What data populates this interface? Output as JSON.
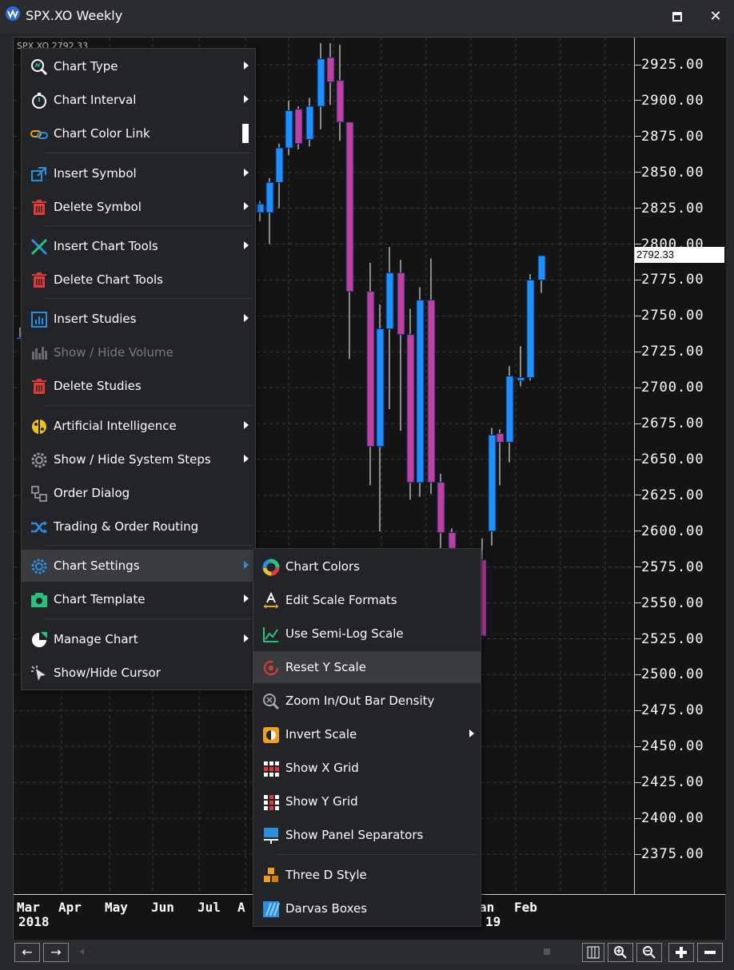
{
  "window": {
    "title": "SPX.XO Weekly",
    "symbol_partial": "SPX.XO  2792.33"
  },
  "chart": {
    "current_price": "2792.33",
    "y_ticks": [
      "2925.00",
      "2900.00",
      "2875.00",
      "2850.00",
      "2825.00",
      "2800.00",
      "2775.00",
      "2750.00",
      "2725.00",
      "2700.00",
      "2675.00",
      "2650.00",
      "2625.00",
      "2600.00",
      "2575.00",
      "2550.00",
      "2525.00",
      "2500.00",
      "2475.00",
      "2450.00",
      "2425.00",
      "2400.00",
      "2375.00"
    ],
    "x_labels_row1": [
      "Mar",
      "Apr",
      "May",
      "Jun",
      "Jul",
      "A",
      "an",
      "Feb"
    ],
    "x_labels_row2": [
      "2018",
      "19"
    ],
    "colors": {
      "up": "#1e90ff",
      "down": "#c040a0",
      "background": "#141414",
      "grid": "#3a3a3a"
    }
  },
  "context_menu": {
    "items": [
      {
        "label": "Chart Type",
        "icon": "chart-type-icon",
        "submenu": true
      },
      {
        "label": "Chart Interval",
        "icon": "stopwatch-icon",
        "submenu": true
      },
      {
        "label": "Chart Color Link",
        "icon": "link-icon",
        "submenu": false
      },
      {
        "label": "Insert Symbol",
        "icon": "insert-symbol-icon",
        "submenu": true
      },
      {
        "label": "Delete Symbol",
        "icon": "trash-icon",
        "submenu": true
      },
      {
        "label": "Insert Chart Tools",
        "icon": "tools-icon",
        "submenu": true
      },
      {
        "label": "Delete Chart Tools",
        "icon": "trash-icon",
        "submenu": false
      },
      {
        "label": "Insert Studies",
        "icon": "studies-icon",
        "submenu": true
      },
      {
        "label": "Show / Hide Volume",
        "icon": "volume-icon",
        "submenu": false,
        "disabled": true
      },
      {
        "label": "Delete Studies",
        "icon": "trash-icon",
        "submenu": false
      },
      {
        "label": "Artificial Intelligence",
        "icon": "brain-icon",
        "submenu": true
      },
      {
        "label": "Show / Hide System Steps",
        "icon": "gear-icon",
        "submenu": true
      },
      {
        "label": "Order Dialog",
        "icon": "order-dialog-icon",
        "submenu": false
      },
      {
        "label": "Trading & Order Routing",
        "icon": "shuffle-icon",
        "submenu": false
      },
      {
        "label": "Chart Settings",
        "icon": "settings-gear-icon",
        "submenu": true,
        "highlighted": true
      },
      {
        "label": "Chart Template",
        "icon": "template-icon",
        "submenu": true
      },
      {
        "label": "Manage Chart",
        "icon": "manage-chart-icon",
        "submenu": true
      },
      {
        "label": "Show/Hide Cursor",
        "icon": "cursor-icon",
        "submenu": false
      }
    ]
  },
  "submenu": {
    "items": [
      {
        "label": "Chart Colors",
        "icon": "color-wheel-icon",
        "submenu": false
      },
      {
        "label": "Edit Scale Formats",
        "icon": "scale-format-icon",
        "submenu": false
      },
      {
        "label": "Use Semi-Log Scale",
        "icon": "semi-log-icon",
        "submenu": false
      },
      {
        "label": "Reset Y Scale",
        "icon": "reset-scale-icon",
        "submenu": false,
        "highlighted": true
      },
      {
        "label": "Zoom In/Out Bar Density",
        "icon": "zoom-density-icon",
        "submenu": false
      },
      {
        "label": "Invert Scale",
        "icon": "invert-scale-icon",
        "submenu": true
      },
      {
        "label": "Show X Grid",
        "icon": "x-grid-icon",
        "submenu": false
      },
      {
        "label": "Show Y Grid",
        "icon": "y-grid-icon",
        "submenu": false
      },
      {
        "label": "Show Panel Separators",
        "icon": "panel-separator-icon",
        "submenu": false
      },
      {
        "label": "Three D Style",
        "icon": "three-d-icon",
        "submenu": false
      },
      {
        "label": "Darvas Boxes",
        "icon": "darvas-icon",
        "submenu": false
      }
    ]
  },
  "bottombar": {
    "left": "←",
    "right": "→"
  }
}
